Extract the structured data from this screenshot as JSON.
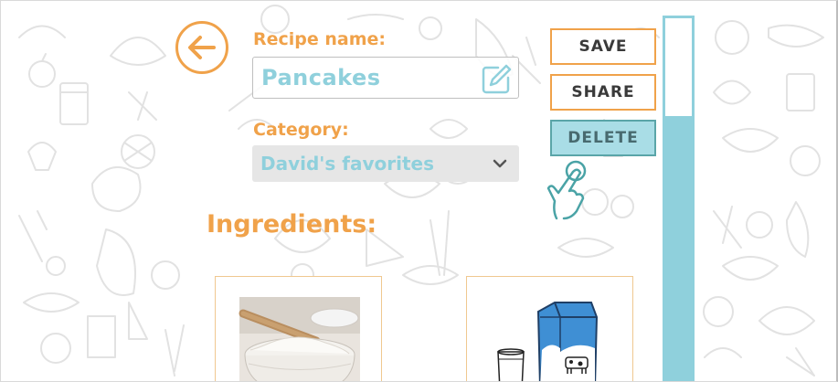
{
  "form": {
    "recipe_name_label": "Recipe name:",
    "recipe_name_value": "Pancakes",
    "category_label": "Category:",
    "category_value": "David's favorites"
  },
  "section": {
    "ingredients_title": "Ingredients:"
  },
  "actions": {
    "save": "SAVE",
    "share": "SHARE",
    "delete": "DELETE"
  },
  "ingredients": [
    {
      "icon": "flour-bowl-image"
    },
    {
      "icon": "milk-carton-image"
    }
  ],
  "colors": {
    "accent_orange": "#f0a24a",
    "accent_teal": "#8fd0dc",
    "delete_bg": "#a9dde6",
    "doodle_gray": "#e2e2e2"
  },
  "scroll": {
    "position_fraction": 0.0
  }
}
